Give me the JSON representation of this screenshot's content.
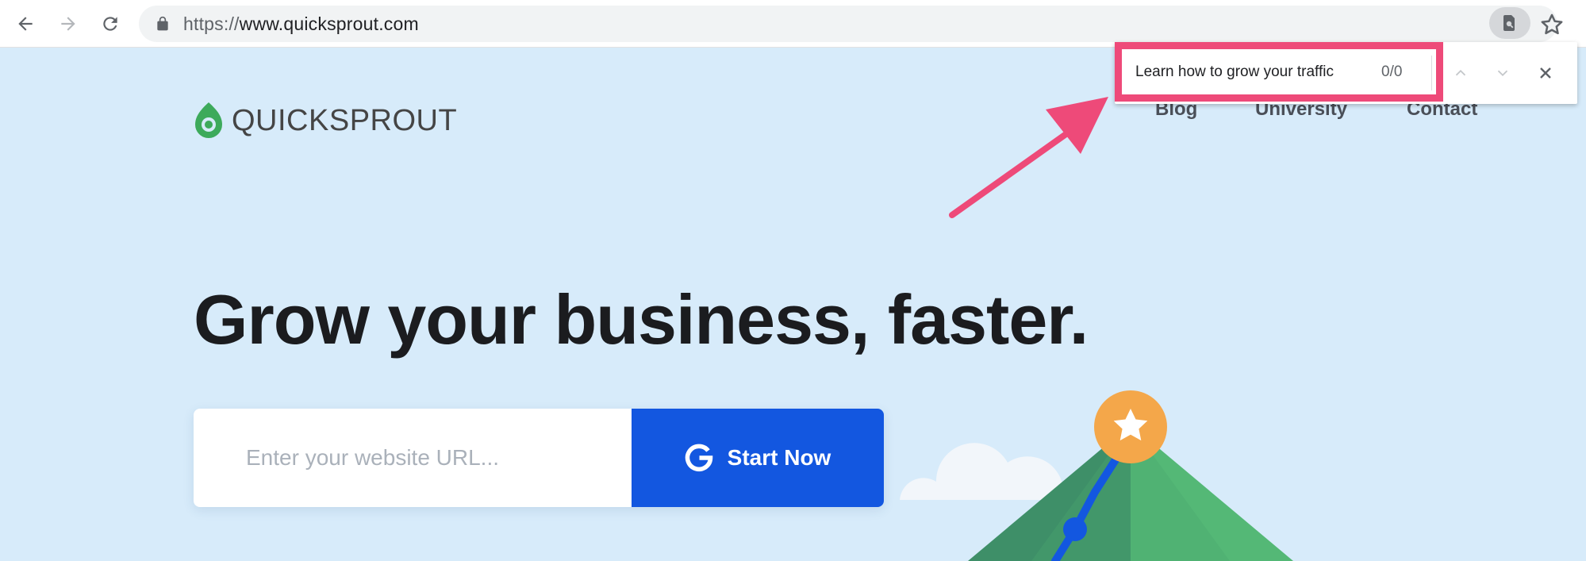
{
  "browser": {
    "url_scheme": "https://",
    "url_host": "www.quicksprout.com",
    "icons": [
      "back-icon",
      "forward-icon",
      "reload-icon",
      "lock-icon",
      "find-in-page-icon",
      "bookmark-star-icon"
    ]
  },
  "find_bar": {
    "query": "Learn how to grow your traffic",
    "count": "0/0",
    "highlight_color": "#ee4a79"
  },
  "site": {
    "logo_text": "QUICKSPROUT",
    "nav": [
      "Blog",
      "University",
      "Contact"
    ],
    "headline": "Grow your business, faster.",
    "url_placeholder": "Enter your website URL...",
    "cta_label": "Start Now",
    "colors": {
      "background": "#d7ebfa",
      "cta": "#1357e0",
      "logo_green": "#3daa5b",
      "mountain": "#43a06d",
      "star_badge": "#f4a74a"
    }
  }
}
